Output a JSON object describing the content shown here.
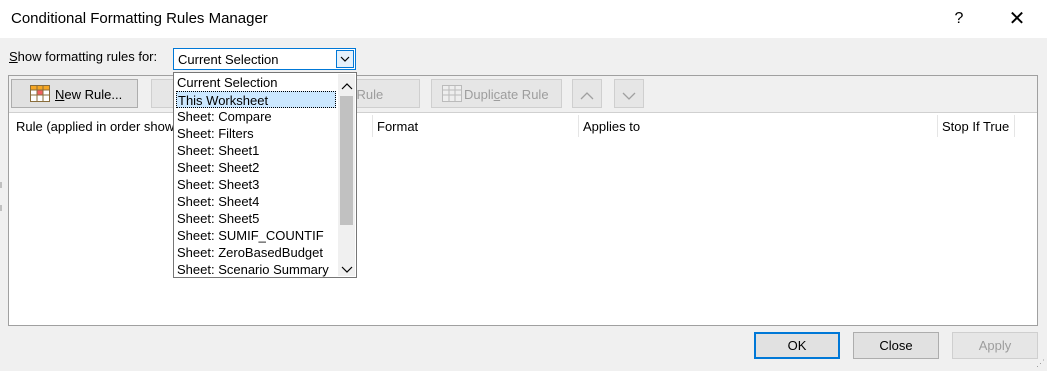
{
  "window": {
    "title": "Conditional Formatting Rules Manager",
    "help": "?",
    "close": "✕"
  },
  "filter": {
    "label_prefix": "S",
    "label_rest": "how formatting rules for:",
    "selected": "Current Selection",
    "options": [
      "Current Selection",
      "This Worksheet",
      "Sheet: Compare",
      "Sheet: Filters",
      "Sheet: Sheet1",
      "Sheet: Sheet2",
      "Sheet: Sheet3",
      "Sheet: Sheet4",
      "Sheet: Sheet5",
      "Sheet: SUMIF_COUNTIF",
      "Sheet: ZeroBasedBudget",
      "Sheet: Scenario Summary"
    ],
    "highlighted": "This Worksheet"
  },
  "toolbar": {
    "new_rule_prefix": "N",
    "new_rule_rest": "ew Rule...",
    "delete_rule": "te Rule",
    "duplicate_rule_prefix": "Dupli",
    "duplicate_rule_underline": "c",
    "duplicate_rule_rest": "ate Rule"
  },
  "columns": {
    "rule": "Rule (applied in order show",
    "format": "Format",
    "applies_to": "Applies to",
    "stop_if_true": "Stop If True"
  },
  "footer": {
    "ok": "OK",
    "close": "Close",
    "apply": "Apply"
  },
  "colors": {
    "accent": "#0078d7",
    "selection": "#cce8ff",
    "disabled_text": "#9d9d9d"
  }
}
